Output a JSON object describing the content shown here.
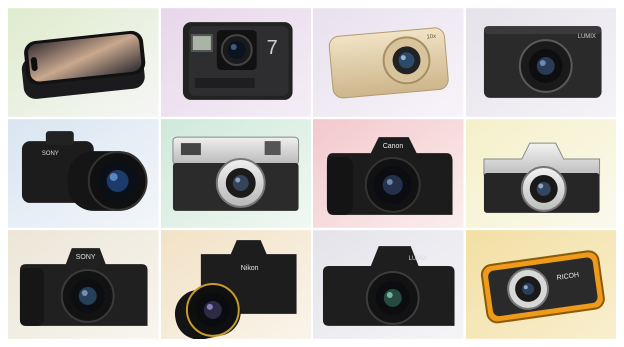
{
  "grid": {
    "tiles": [
      {
        "name": "smartphone-tile",
        "bg": [
          "#dfeccd",
          "#f6f6f6"
        ],
        "label": ""
      },
      {
        "name": "action-camera-tile",
        "bg": [
          "#e8d6ea",
          "#f4eef6"
        ],
        "label": "7"
      },
      {
        "name": "compact-camera-gold-tile",
        "bg": [
          "#e9e1ee",
          "#f7f4f9"
        ],
        "label": "10x"
      },
      {
        "name": "premium-compact-tile",
        "bg": [
          "#e6e2eb",
          "#f5f3f7"
        ],
        "label": "LUMIX"
      },
      {
        "name": "bridge-camera-tile",
        "bg": [
          "#d9e5f1",
          "#f3f6fa"
        ],
        "label": "SONY"
      },
      {
        "name": "retro-silver-camera-tile",
        "bg": [
          "#cfe9d9",
          "#f1f8f3"
        ],
        "label": ""
      },
      {
        "name": "canon-dslr-tile",
        "bg": [
          "#f3c8cc",
          "#fbeeee"
        ],
        "label": "Canon"
      },
      {
        "name": "silver-mirrorless-tile",
        "bg": [
          "#f5f0c9",
          "#fbf9ee"
        ],
        "label": ""
      },
      {
        "name": "sony-mirrorless-tile",
        "bg": [
          "#ece6d7",
          "#f8f5ef"
        ],
        "label": "SONY"
      },
      {
        "name": "nikon-dslr-tile",
        "bg": [
          "#f2e2c6",
          "#faf4ea"
        ],
        "label": "Nikon"
      },
      {
        "name": "lumix-mirrorless-tile",
        "bg": [
          "#e4e3ea",
          "#f5f5f8"
        ],
        "label": "LUMIX"
      },
      {
        "name": "rugged-camera-tile",
        "bg": [
          "#f2dfa3",
          "#f9efcf"
        ],
        "label": "RICOH"
      }
    ]
  }
}
